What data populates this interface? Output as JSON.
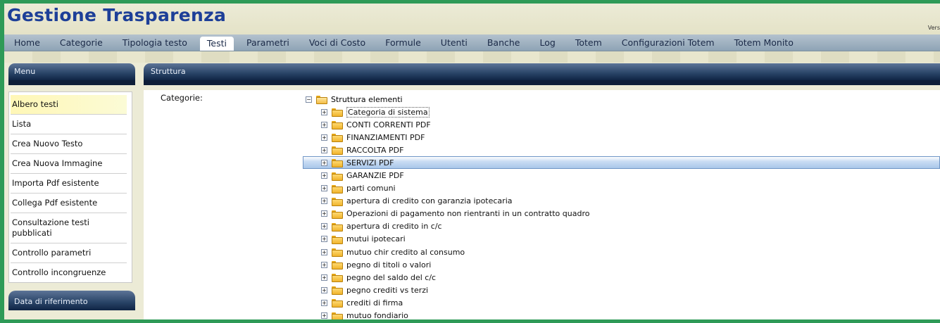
{
  "app": {
    "title": "Gestione Trasparenza",
    "version_label": "Vers"
  },
  "nav": {
    "items": [
      {
        "label": "Home"
      },
      {
        "label": "Categorie"
      },
      {
        "label": "Tipologia testo"
      },
      {
        "label": "Testi",
        "active": true
      },
      {
        "label": "Parametri"
      },
      {
        "label": "Voci di Costo"
      },
      {
        "label": "Formule"
      },
      {
        "label": "Utenti"
      },
      {
        "label": "Banche"
      },
      {
        "label": "Log"
      },
      {
        "label": "Totem"
      },
      {
        "label": "Configurazioni Totem"
      },
      {
        "label": "Totem Monito"
      }
    ]
  },
  "sidebar": {
    "title": "Menu",
    "items": [
      {
        "label": "Albero testi",
        "selected": true
      },
      {
        "label": "Lista"
      },
      {
        "label": "Crea Nuovo Testo"
      },
      {
        "label": "Crea Nuova Immagine"
      },
      {
        "label": "Importa Pdf esistente"
      },
      {
        "label": "Collega Pdf esistente"
      },
      {
        "label": "Consultazione testi pubblicati"
      },
      {
        "label": "Controllo parametri"
      },
      {
        "label": "Controllo incongruenze"
      }
    ],
    "date_panel_title": "Data di riferimento"
  },
  "main": {
    "title": "Struttura",
    "categories_label": "Categorie:",
    "tree": {
      "root_label": "Struttura elementi",
      "root_expander": "−",
      "child_expander": "+",
      "items": [
        {
          "label": "Categoria di sistema",
          "focused": true
        },
        {
          "label": "CONTI CORRENTI PDF"
        },
        {
          "label": "FINANZIAMENTI PDF"
        },
        {
          "label": "RACCOLTA PDF"
        },
        {
          "label": "SERVIZI PDF",
          "highlighted": true
        },
        {
          "label": "GARANZIE PDF"
        },
        {
          "label": "parti comuni"
        },
        {
          "label": "apertura di credito con garanzia ipotecaria"
        },
        {
          "label": "Operazioni di pagamento non rientranti in un contratto quadro"
        },
        {
          "label": "apertura di credito in c/c"
        },
        {
          "label": "mutui ipotecari"
        },
        {
          "label": "mutuo chir credito al consumo"
        },
        {
          "label": "pegno di titoli o valori"
        },
        {
          "label": "pegno del saldo del c/c"
        },
        {
          "label": "pegno crediti vs terzi"
        },
        {
          "label": "crediti di firma"
        },
        {
          "label": "mutuo fondiario"
        }
      ]
    }
  },
  "colors": {
    "border": "#2e9a57",
    "title": "#1d3f98",
    "panel_header": "#284366",
    "selection": "#a9c7ea",
    "menu_selected": "#fff7b6"
  }
}
